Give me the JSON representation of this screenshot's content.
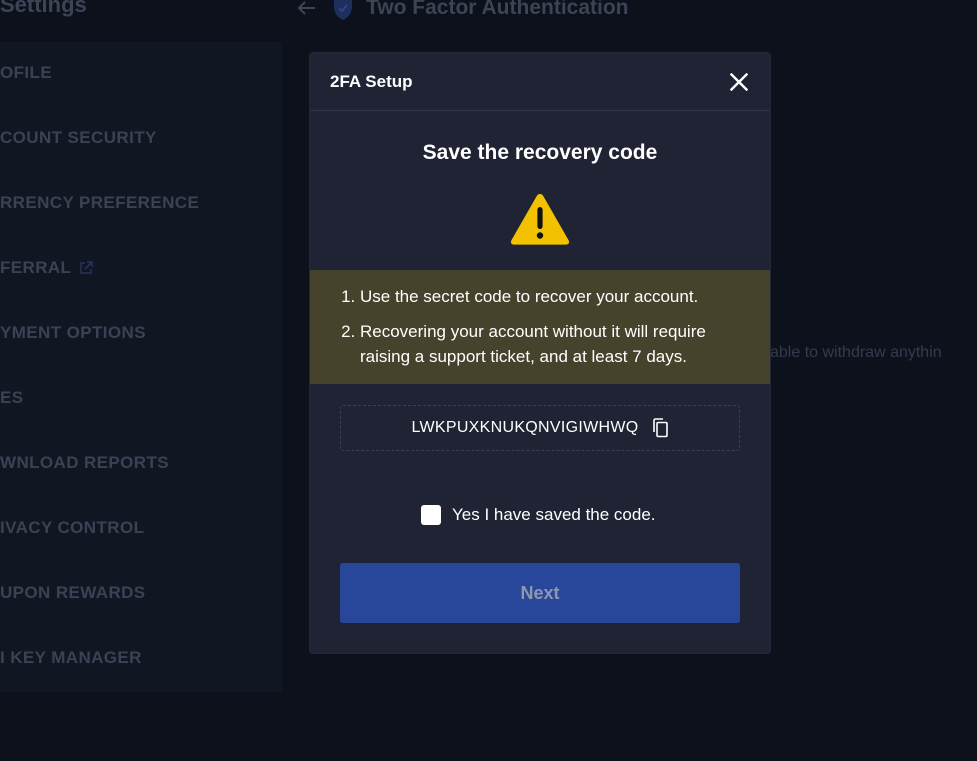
{
  "background": {
    "settings_title": "Settings",
    "sidebar": {
      "items": [
        {
          "label": "OFILE"
        },
        {
          "label": "COUNT SECURITY"
        },
        {
          "label": "RRENCY PREFERENCE"
        },
        {
          "label": "FERRAL",
          "icon": "external-link-icon"
        },
        {
          "label": "YMENT OPTIONS"
        },
        {
          "label": "ES"
        },
        {
          "label": "WNLOAD REPORTS"
        },
        {
          "label": "IVACY CONTROL"
        },
        {
          "label": "UPON REWARDS"
        },
        {
          "label": "I KEY MANAGER"
        }
      ]
    },
    "page_title": "Two Factor Authentication",
    "body_text_fragment": "able to withdraw anythin"
  },
  "modal": {
    "title": "2FA Setup",
    "heading": "Save the recovery code",
    "warning_icon": "warning-triangle-icon",
    "notice_items": [
      "Use the secret code to recover your account.",
      "Recovering your account without it will require raising a support ticket, and at least 7 days."
    ],
    "recovery_code": "LWKPUXKNUKQNVIGIWHWQ",
    "copy_icon": "copy-icon",
    "confirm_label": "Yes I have saved the code.",
    "confirm_checked": false,
    "next_label": "Next"
  },
  "colors": {
    "page_bg": "#0d111c",
    "modal_bg": "#1f2333",
    "notice_bg": "#45432c",
    "warning_yellow": "#f2c200",
    "button_bg": "#28479a",
    "button_text_disabled": "#8e97ad"
  }
}
